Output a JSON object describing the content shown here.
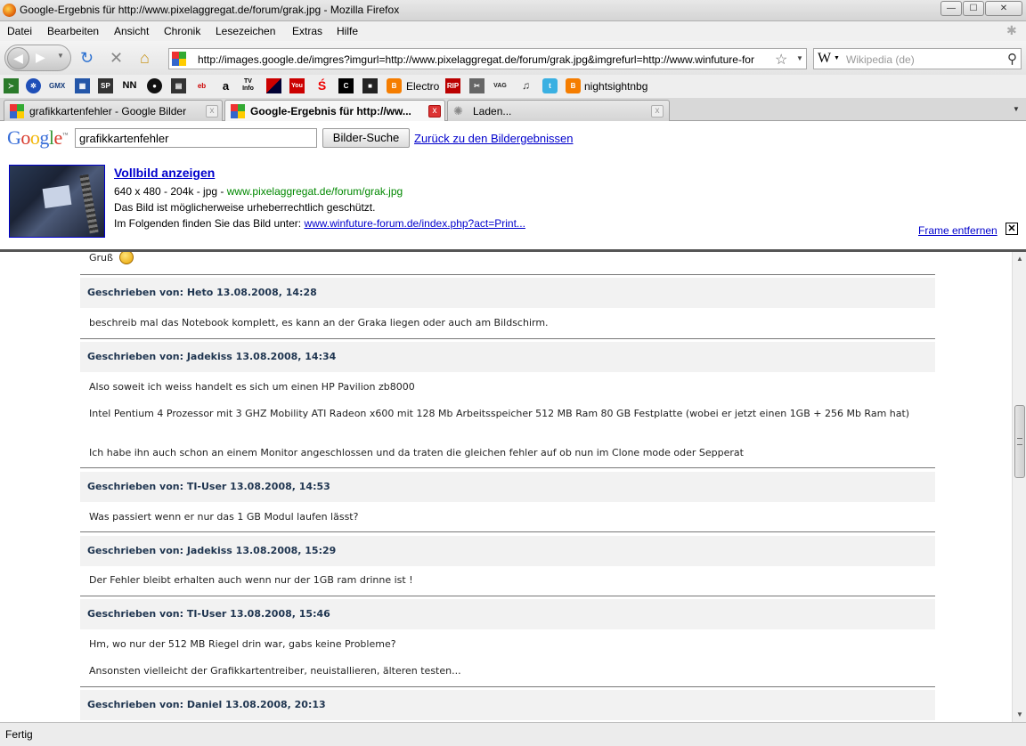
{
  "window": {
    "title": "Google-Ergebnis für http://www.pixelaggregat.de/forum/grak.jpg - Mozilla Firefox",
    "buttons": {
      "minimize": "—",
      "maximize": "☐",
      "close": "✕"
    }
  },
  "menu": [
    "Datei",
    "Bearbeiten",
    "Ansicht",
    "Chronik",
    "Lesezeichen",
    "Extras",
    "Hilfe"
  ],
  "nav": {
    "url": "http://images.google.de/imgres?imgurl=http://www.pixelaggregat.de/forum/grak.jpg&imgrefurl=http://www.winfuture-for",
    "search_placeholder": "Wikipedia (de)",
    "search_engine_glyph": "W"
  },
  "bookmarks": {
    "labels": [
      "GMX",
      "NN",
      "TV Info",
      "Electro",
      "nightsightnbg"
    ],
    "icons": [
      "bookmark-green-icon",
      "settings-star-icon",
      "gmx-icon",
      "puzzle-icon",
      "spon-icon",
      "nn-icon",
      "record-icon",
      "film-icon",
      "ebay-icon",
      "amazon-icon",
      "tvinfo-icon",
      "flag-icon",
      "youtube-icon",
      "sparkasse-icon",
      "c-icon",
      "square-icon",
      "blogger-icon",
      "rip-icon",
      "scissors-icon",
      "vag-icon",
      "music-icon",
      "twitter-icon",
      "blogger-icon"
    ]
  },
  "tabs": [
    {
      "label": "grafikkartenfehler - Google Bilder",
      "close": "x"
    },
    {
      "label": "Google-Ergebnis für http://ww...",
      "close": "x"
    },
    {
      "label": "Laden...",
      "close": "x"
    }
  ],
  "google": {
    "logo": "Google",
    "logo_tm": "™",
    "query": "grafikkartenfehler",
    "search_button": "Bilder-Suche",
    "back_link": "Zurück zu den Bildergebnissen",
    "fullimage_link": "Vollbild anzeigen",
    "meta": "640 x 480 - 204k - jpg - ",
    "source": "www.pixelaggregat.de/forum/grak.jpg",
    "copyright": "Das Bild ist möglicherweise urheberrechtlich geschützt.",
    "page_prefix": "Im Folgenden finden Sie das Bild unter: ",
    "page_link": "www.winfuture-forum.de/index.php?act=Print...",
    "remove_frame": "Frame entfernen",
    "remove_x": "✕"
  },
  "forum": {
    "greeting": "Gruß",
    "posts": [
      {
        "header": "Geschrieben von: Heto 13.08.2008, 14:28",
        "lines": [
          "beschreib mal das Notebook komplett, es kann an der Graka liegen oder auch am Bildschirm."
        ]
      },
      {
        "header": "Geschrieben von: Jadekiss 13.08.2008, 14:34",
        "lines": [
          "Also soweit ich weiss handelt es sich um einen HP Pavilion zb8000",
          "Intel Pentium 4 Prozessor mit 3 GHZ Mobility ATI Radeon x600 mit 128 Mb Arbeitsspeicher 512 MB Ram 80 GB Festplatte (wobei er jetzt einen 1GB + 256 Mb Ram hat)",
          "Ich habe ihn auch schon an einem Monitor angeschlossen und da traten die gleichen fehler auf ob nun im Clone mode oder Sepperat"
        ]
      },
      {
        "header": "Geschrieben von: TI-User 13.08.2008, 14:53",
        "lines": [
          "Was passiert wenn er nur das 1 GB Modul laufen lässt?"
        ]
      },
      {
        "header": "Geschrieben von: Jadekiss 13.08.2008, 15:29",
        "lines": [
          "Der Fehler bleibt erhalten auch wenn nur der 1GB ram drinne ist !"
        ]
      },
      {
        "header": "Geschrieben von: TI-User 13.08.2008, 15:46",
        "lines": [
          "Hm, wo nur der 512 MB Riegel drin war, gabs keine Probleme?",
          "Ansonsten vielleicht der Grafikkartentreiber, neuistallieren, älteren testen..."
        ]
      },
      {
        "header": "Geschrieben von: Daniel 13.08.2008, 20:13",
        "lines": []
      }
    ]
  },
  "status": "Fertig"
}
